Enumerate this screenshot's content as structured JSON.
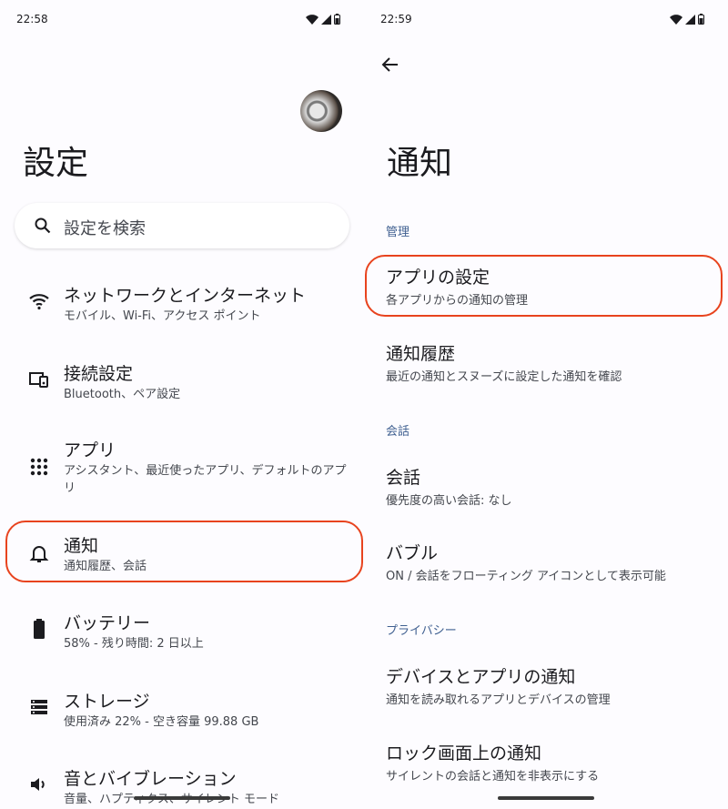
{
  "left": {
    "status": {
      "time": "22:58"
    },
    "title": "設定",
    "search": {
      "placeholder": "設定を検索"
    },
    "items": [
      {
        "title": "ネットワークとインターネット",
        "sub": "モバイル、Wi-Fi、アクセス ポイント",
        "icon": "wifi-icon"
      },
      {
        "title": "接続設定",
        "sub": "Bluetooth、ペア設定",
        "icon": "devices-icon"
      },
      {
        "title": "アプリ",
        "sub": "アシスタント、最近使ったアプリ、デフォルトのアプリ",
        "icon": "apps-grid-icon"
      },
      {
        "title": "通知",
        "sub": "通知履歴、会話",
        "icon": "bell-icon"
      },
      {
        "title": "バッテリー",
        "sub": "58% - 残り時間: 2 日以上",
        "icon": "battery-icon"
      },
      {
        "title": "ストレージ",
        "sub": "使用済み 22% - 空き容量 99.88 GB",
        "icon": "storage-icon"
      },
      {
        "title": "音とバイブレーション",
        "sub": "音量、ハプティクス、サイレント モード",
        "icon": "volume-icon"
      }
    ]
  },
  "right": {
    "status": {
      "time": "22:59"
    },
    "title": "通知",
    "sections": [
      {
        "label": "管理",
        "items": [
          {
            "title": "アプリの設定",
            "sub": "各アプリからの通知の管理"
          },
          {
            "title": "通知履歴",
            "sub": "最近の通知とスヌーズに設定した通知を確認"
          }
        ]
      },
      {
        "label": "会話",
        "items": [
          {
            "title": "会話",
            "sub": "優先度の高い会話: なし"
          },
          {
            "title": "バブル",
            "sub": "ON / 会話をフローティング アイコンとして表示可能"
          }
        ]
      },
      {
        "label": "プライバシー",
        "items": [
          {
            "title": "デバイスとアプリの通知",
            "sub": "通知を読み取れるアプリとデバイスの管理"
          },
          {
            "title": "ロック画面上の通知",
            "sub": "サイレントの会話と通知を非表示にする"
          }
        ]
      }
    ]
  },
  "colors": {
    "highlight": "#e8431e",
    "section_label": "#3f5f90",
    "background": "#fdfcff"
  }
}
